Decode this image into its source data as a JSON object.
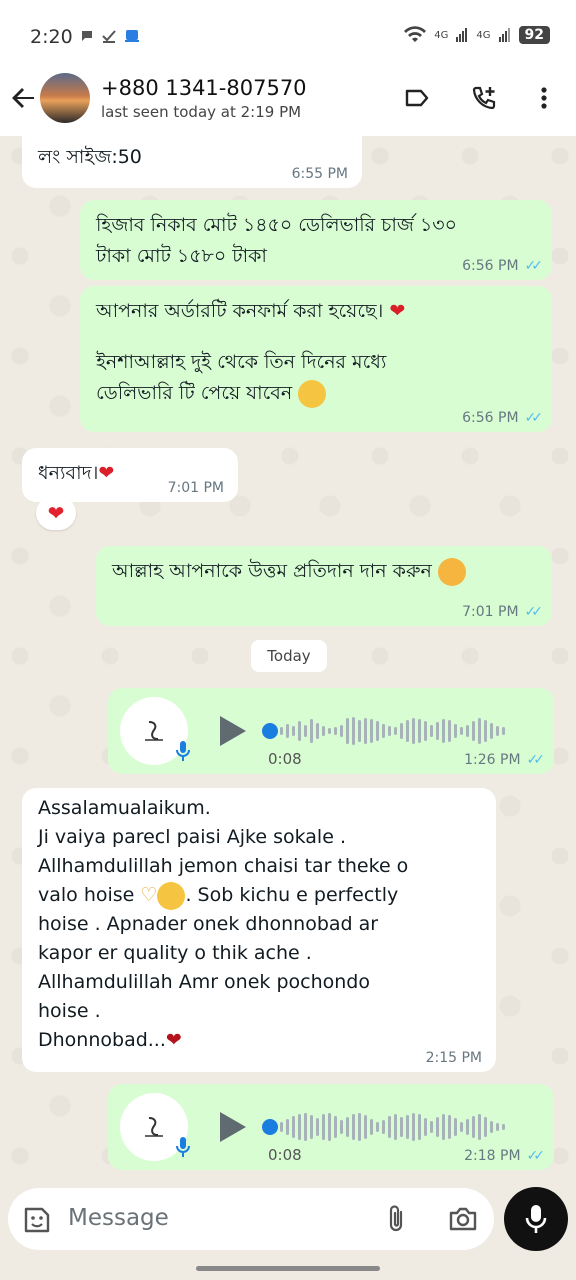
{
  "statusbar": {
    "time": "2:20",
    "signal1": "4G",
    "signal2": "4G",
    "battery": "92"
  },
  "header": {
    "name": "+880 1341-807570",
    "status": "last seen today at 2:19 PM",
    "icons": [
      "back-arrow-icon",
      "label-icon",
      "add-call-icon",
      "more-vert-icon"
    ]
  },
  "messages": [
    {
      "dir": "in",
      "text": "লং সাইজ:50",
      "time": "6:55 PM"
    },
    {
      "dir": "out",
      "line1": "হিজাব নিকাব মোট ১৪৫০ ডেলিভারি চার্জ ১৩০",
      "line2": "টাকা মোট ১৫৮০ টাকা",
      "time": "6:56 PM"
    },
    {
      "dir": "out",
      "line1": "আপনার অর্ডারটি কনফার্ম করা হয়েছে।",
      "line2": "ইনশাআল্লাহ  দুই থেকে তিন দিনের মধ্যে",
      "line3": "ডেলিভারি টি পেয়ে যাবেন",
      "time": "6:56 PM"
    },
    {
      "dir": "in",
      "text": "ধন্যবাদ।",
      "time": "7:01 PM",
      "reaction": "❤"
    },
    {
      "dir": "out",
      "text": "আল্লাহ আপনাকে উত্তম প্রতিদান দান করুন",
      "time": "7:01 PM"
    }
  ],
  "date_chip": "Today",
  "voice_notes": [
    {
      "duration": "0:08",
      "time": "1:26 PM"
    },
    {
      "duration": "0:08",
      "time": "2:18 PM"
    }
  ],
  "long_message": {
    "lines": [
      "Assalamualaikum.",
      "Ji vaiya parecl paisi Ajke sokale .",
      "Allhamdulillah jemon chaisi tar theke o",
      "valo hoise",
      ". Sob kichu e perfectly",
      "hoise . Apnader onek dhonnobad ar",
      "kapor er quality o thik ache .",
      "Allhamdulillah Amr onek pochondo",
      "hoise .",
      "Dhonnobad..."
    ],
    "time": "2:15 PM"
  },
  "input": {
    "placeholder": "Message"
  },
  "colors": {
    "outgoing": "#d9fdd3",
    "incoming": "#ffffff",
    "wallpaper": "#efeae2",
    "ticks": "#53bdeb"
  }
}
